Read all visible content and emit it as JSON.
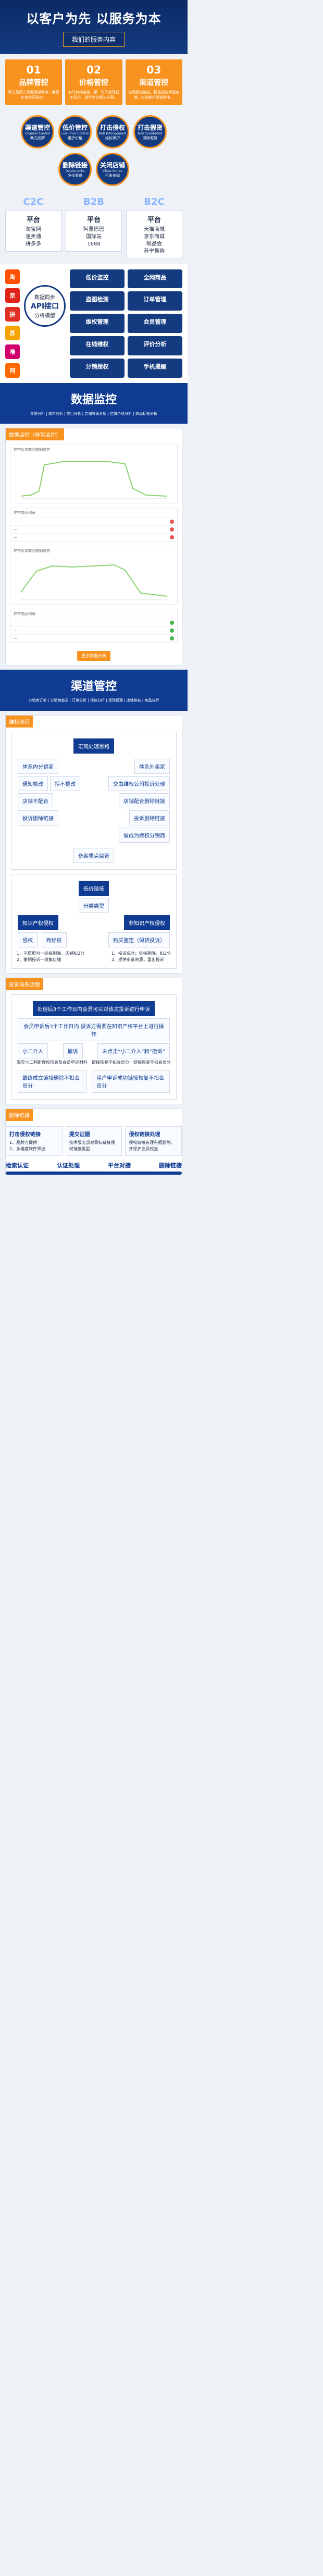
{
  "hero": {
    "title": "以客户为先 以服务为本",
    "pill": "我们的服务内容"
  },
  "cards": [
    {
      "num": "01",
      "title": "品牌管控",
      "desc": "助力品牌方掌握渠道秩序，确保价格体系稳定。"
    },
    {
      "num": "02",
      "title": "价格管控",
      "desc": "实时价格监控，第一时间发现低价乱价，提供专业解决方案。"
    },
    {
      "num": "03",
      "title": "渠道管控",
      "desc": "全网渠道监控，精准定位问题店铺，协助维护渠道秩序。"
    }
  ],
  "circles": [
    {
      "title": "渠道管控",
      "en": "Channel Control",
      "sub": "助力品牌"
    },
    {
      "title": "低价管控",
      "en": "Low Price Control",
      "sub": "维护价格"
    },
    {
      "title": "打击侵权",
      "en": "Anti Infringement",
      "sub": "维权保护"
    },
    {
      "title": "打击假货",
      "en": "Anti Counterfeit",
      "sub": "清除假货"
    },
    {
      "title": "删除链接",
      "en": "Delete Links",
      "sub": "净化渠道"
    },
    {
      "title": "关闭店铺",
      "en": "Close Stores",
      "sub": "打击违规"
    }
  ],
  "platform": {
    "cols": [
      {
        "k": "C2C",
        "name": "平台",
        "items": [
          "淘宝网",
          "速卖通",
          "拼多多"
        ]
      },
      {
        "k": "B2B",
        "name": "平台",
        "items": [
          "阿里巴巴",
          "国际站",
          "1688"
        ]
      },
      {
        "k": "B2C",
        "name": "平台",
        "items": [
          "天猫商城",
          "京东商城",
          "唯品会",
          "苏宁易购"
        ]
      }
    ]
  },
  "api": {
    "icons": [
      "淘",
      "京",
      "拼",
      "苏",
      "唯",
      "阿"
    ],
    "hubTop": "数据同步",
    "hubMid": "API接口",
    "hubBot": "分析模型",
    "features": [
      "低价监控",
      "全网商品",
      "盗图检测",
      "订单管理",
      "维权管理",
      "会员管理",
      "在线维权",
      "评价分析",
      "分销授权",
      "手机提醒"
    ]
  },
  "monitor": {
    "title": "数据监控",
    "tabs": "异常分析 | 城市分析 | 类目分析 | 店铺等级分析 | 店铺价格分析 | 商品标签分析",
    "panelHd": "数据监控（异常监控）",
    "chart1": "异常价格商品数据趋势",
    "list1": "异常商品列表",
    "chart2": "异常价格商品数据趋势",
    "list2": "异常商品列表",
    "btn": "更多数据分析"
  },
  "channel": {
    "title": "渠道管控",
    "tabs": "分销商订单 | 分销商会员 | 订单分析 | 评价分析 | 活动管理 | 店铺排名 | 商品分析",
    "rightsHd": "维权流程",
    "rights": {
      "top": "宏观处理思路",
      "left": "体系内分销商",
      "right": "体系外卖家",
      "l1": "通知整改",
      "l2": "拒不整改",
      "r1": "交由维权公司投诉处理",
      "l3": "店铺不配合",
      "l4": "投诉删除链接",
      "r2": "店铺配合删除链接",
      "r3": "投诉删除链接",
      "r4": "做成为授权分销商",
      "bottom": "备案重点监管"
    },
    "lowprice": {
      "top": "低价链接",
      "mid": "分类类型",
      "left": "知识产权侵权",
      "right": "非知识产权侵权",
      "left1": "侵权",
      "left2": "商标权",
      "right1": "购买鉴定（假货投诉）",
      "l_note": "1、不愿配合一链接删除，店铺扣2分\n2、撤销投诉一收集店铺",
      "r_note": "1、投诉成立：链接删除，扣2分\n2、提供申诉资质，重出投诉"
    },
    "complainHd": "投诉联系流程",
    "complain": {
      "top": "处理后3个工作日内会员可以对该次投诉进行申诉",
      "step2": "会员申诉后3个工作日内 投诉方需要在知识产权平台上进行操作",
      "step2_note": "未点击“小二介入”和“撤诉”",
      "a": "小二介入",
      "b": "撤诉",
      "a_note": "淘宝小二判断侵权信息及会员申诉材料",
      "b_note": "链接恢复不扣会员分",
      "c_note": "链接恢复不扣会员分",
      "final_left": "最终成立链接删除不扣会员分",
      "final_right": "用户申诉成功链接恢复不扣会员分"
    },
    "deleteHd": "删除链接",
    "timeline": [
      {
        "t": "打击侵权链接",
        "d": "1、品牌方提供\n2、多维度软件筛选"
      },
      {
        "t": "提交证据",
        "d": "技术服务部对目标链接侵权链接类型"
      },
      {
        "t": "侵权链接处理",
        "d": "侵权链接有理有据删除，并保护会员权益"
      }
    ],
    "ribbon": [
      "检索认证",
      "认证处理",
      "平台对接",
      "删除链接"
    ]
  }
}
